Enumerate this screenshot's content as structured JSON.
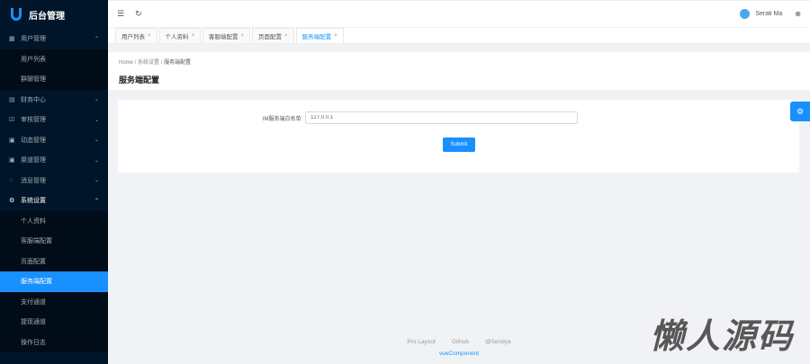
{
  "app": {
    "title": "后台管理"
  },
  "sidebar": {
    "items": [
      {
        "label": "用户管理",
        "icon": "table-icon",
        "expanded": true,
        "children": [
          {
            "label": "用户列表"
          },
          {
            "label": "群聊管理"
          }
        ]
      },
      {
        "label": "财务中心",
        "icon": "file-icon"
      },
      {
        "label": "审核管理",
        "icon": "check-square-icon"
      },
      {
        "label": "动态管理",
        "icon": "layout-icon"
      },
      {
        "label": "渠道管理",
        "icon": "layout-icon"
      },
      {
        "label": "消息管理",
        "icon": "message-icon"
      },
      {
        "label": "系统设置",
        "icon": "gear-icon",
        "expanded": true,
        "children": [
          {
            "label": "个人资料"
          },
          {
            "label": "客服端配置"
          },
          {
            "label": "页面配置"
          },
          {
            "label": "服务端配置",
            "selected": true
          },
          {
            "label": "支付通道"
          },
          {
            "label": "提现通道"
          },
          {
            "label": "操作日志"
          }
        ]
      }
    ]
  },
  "header": {
    "user": "Serati Ma"
  },
  "tabs": [
    {
      "label": "用户列表"
    },
    {
      "label": "个人资料"
    },
    {
      "label": "客服端配置"
    },
    {
      "label": "页面配置"
    },
    {
      "label": "服务端配置",
      "active": true
    }
  ],
  "breadcrumb": [
    "Home",
    "系统设置",
    "服务端配置"
  ],
  "page": {
    "title": "服务端配置"
  },
  "form": {
    "label": "IM服务端白名单:",
    "value": "127.0.0.1",
    "submit": "Submit"
  },
  "footer": {
    "links": [
      "Pro Layout",
      "Github",
      "@Sendya"
    ],
    "credit": "vueComponent"
  },
  "watermark": "懒人源码",
  "colors": {
    "primary": "#1890ff",
    "sider": "#001529"
  }
}
